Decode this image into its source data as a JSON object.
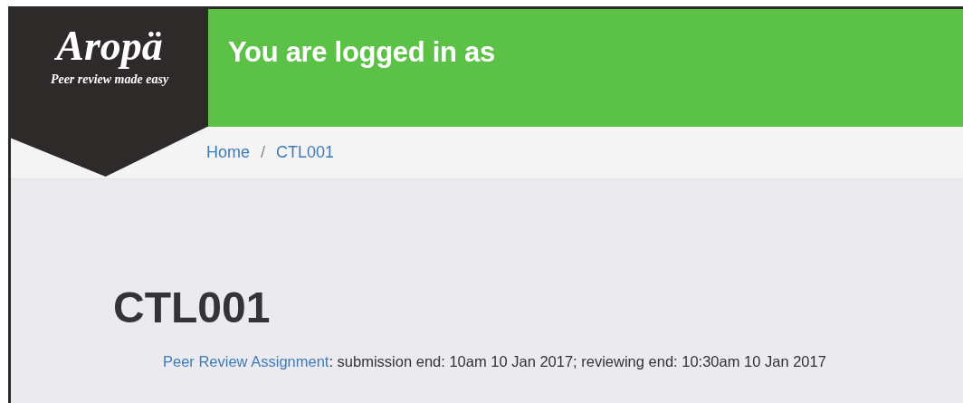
{
  "logo": {
    "title": "Aropä",
    "tagline": "Peer review made easy"
  },
  "header": {
    "title": "You are logged in as"
  },
  "breadcrumb": {
    "separator": "/",
    "items": [
      {
        "label": "Home"
      },
      {
        "label": "CTL001"
      }
    ]
  },
  "page": {
    "title": "CTL001",
    "assignment_link": "Peer Review Assignment",
    "assignment_details": ": submission end: 10am 10 Jan 2017; reviewing end: 10:30am 10 Jan 2017"
  }
}
